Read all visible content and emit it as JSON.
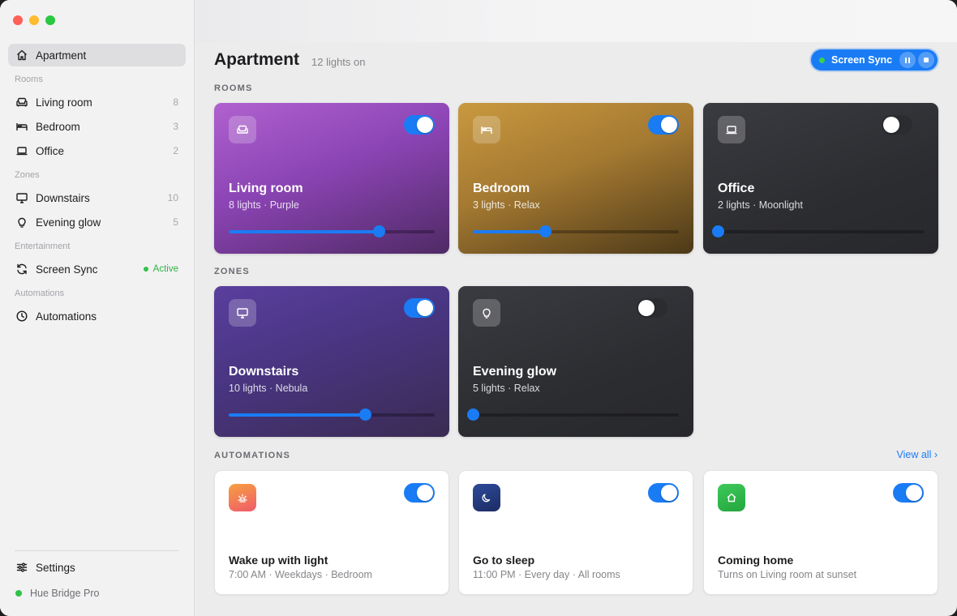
{
  "sidebar": {
    "home": {
      "label": "Apartment",
      "icon": "home-icon"
    },
    "rooms_header": "Rooms",
    "rooms": [
      {
        "label": "Living room",
        "count": "8",
        "icon": "sofa-icon"
      },
      {
        "label": "Bedroom",
        "count": "3",
        "icon": "bed-icon"
      },
      {
        "label": "Office",
        "count": "2",
        "icon": "laptop-icon"
      }
    ],
    "zones_header": "Zones",
    "zones": [
      {
        "label": "Downstairs",
        "count": "10",
        "icon": "monitor-icon"
      },
      {
        "label": "Evening glow",
        "count": "5",
        "icon": "bulb-icon"
      }
    ],
    "entertainment_header": "Entertainment",
    "entertainment": {
      "label": "Screen Sync",
      "status": "Active",
      "icon": "sync-icon"
    },
    "automations_header": "Automations",
    "automations_item": {
      "label": "Automations",
      "icon": "clock-icon"
    },
    "settings": {
      "label": "Settings",
      "icon": "sliders-icon"
    },
    "bridge": {
      "label": "Hue Bridge Pro",
      "status_color": "#2fc24a"
    }
  },
  "header": {
    "title": "Apartment",
    "subtitle": "12 lights on",
    "sync_pill": {
      "label": "Screen Sync"
    }
  },
  "sections": {
    "rooms": "ROOMS",
    "zones": "ZONES",
    "automations": "AUTOMATIONS",
    "view_all": "View all ›"
  },
  "rooms": [
    {
      "name": "Living room",
      "subtitle": "8 lights · Purple",
      "on": true,
      "brightness": 0.73
    },
    {
      "name": "Bedroom",
      "subtitle": "3 lights · Relax",
      "on": true,
      "brightness": 0.35
    },
    {
      "name": "Office",
      "subtitle": "2 lights · Moonlight",
      "on": false,
      "brightness": 0.0
    }
  ],
  "zones": [
    {
      "name": "Downstairs",
      "subtitle": "10 lights · Nebula",
      "on": true,
      "brightness": 0.66
    },
    {
      "name": "Evening glow",
      "subtitle": "5 lights · Relax",
      "on": false,
      "brightness": 0.0
    }
  ],
  "automations": [
    {
      "name": "Wake up with light",
      "subtitle": "7:00 AM · Weekdays · Bedroom",
      "on": true,
      "icon": "sunrise-icon"
    },
    {
      "name": "Go to sleep",
      "subtitle": "11:00 PM · Every day · All rooms",
      "on": true,
      "icon": "moon-icon"
    },
    {
      "name": "Coming home",
      "subtitle": "Turns on Living room at sunset",
      "on": true,
      "icon": "house-icon"
    }
  ],
  "colors": {
    "accent": "#1a7cf5",
    "active_green": "#2fc24a"
  }
}
